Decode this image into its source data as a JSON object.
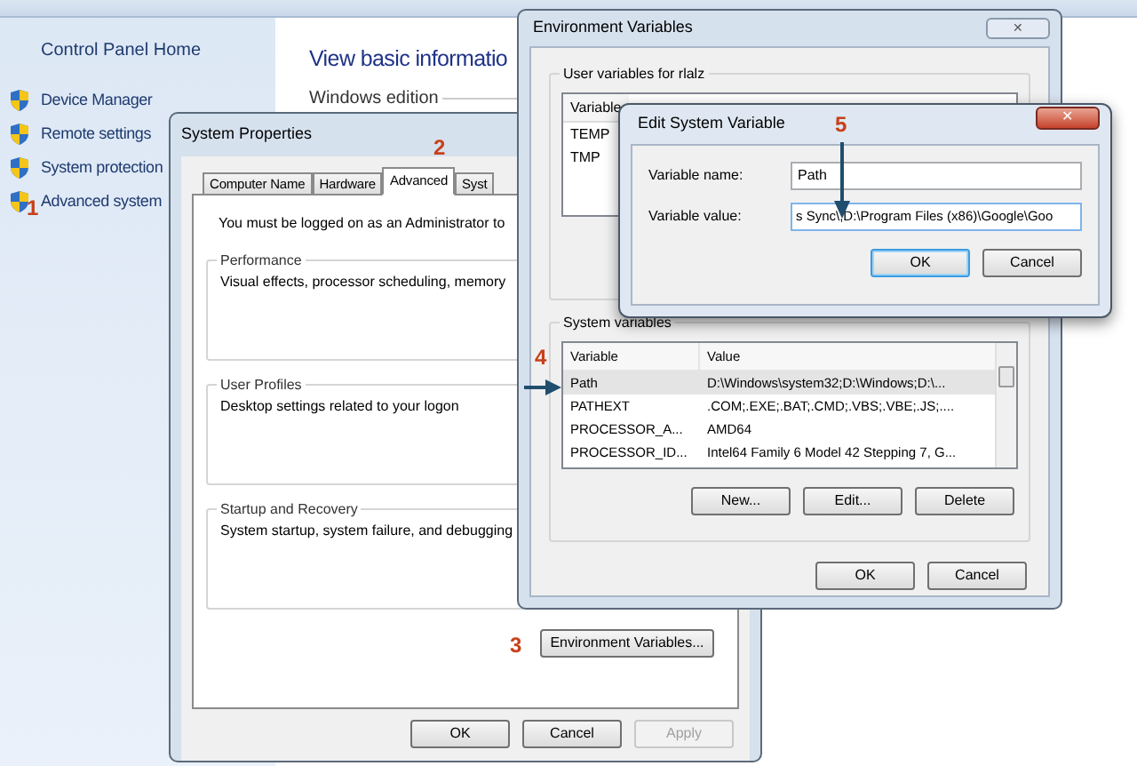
{
  "control_panel": {
    "home_link": "Control Panel Home",
    "tasks": [
      {
        "label": "Device Manager"
      },
      {
        "label": "Remote settings"
      },
      {
        "label": "System protection"
      },
      {
        "label": "Advanced system"
      }
    ],
    "heading": "View basic informatio",
    "section": "Windows edition"
  },
  "system_properties": {
    "title": "System Properties",
    "tabs": [
      {
        "label": "Computer Name",
        "selected": false
      },
      {
        "label": "Hardware",
        "selected": false
      },
      {
        "label": "Advanced",
        "selected": true
      },
      {
        "label": "Syst",
        "selected": false
      }
    ],
    "notice": "You must be logged on as an Administrator to",
    "groups": [
      {
        "title": "Performance",
        "description": "Visual effects, processor scheduling, memory"
      },
      {
        "title": "User Profiles",
        "description": "Desktop settings related to your logon"
      },
      {
        "title": "Startup and Recovery",
        "description": "System startup, system failure, and debugging"
      }
    ],
    "env_button": "Environment Variables...",
    "buttons": [
      {
        "label": "OK",
        "disabled": false
      },
      {
        "label": "Cancel",
        "disabled": false
      },
      {
        "label": "Apply",
        "disabled": true
      }
    ]
  },
  "environment_variables": {
    "title": "Environment Variables",
    "close": "✕",
    "user_section": {
      "title": "User variables for rlalz",
      "column": "Variable",
      "rows": [
        "TEMP",
        "TMP"
      ]
    },
    "system_section": {
      "title": "System variables",
      "columns": [
        "Variable",
        "Value"
      ],
      "rows": [
        {
          "name": "Path",
          "value": "D:\\Windows\\system32;D:\\Windows;D:\\...",
          "selected": true
        },
        {
          "name": "PATHEXT",
          "value": ".COM;.EXE;.BAT;.CMD;.VBS;.VBE;.JS;....",
          "selected": false
        },
        {
          "name": "PROCESSOR_A...",
          "value": "AMD64",
          "selected": false
        },
        {
          "name": "PROCESSOR_ID...",
          "value": "Intel64 Family 6 Model 42 Stepping 7, G...",
          "selected": false
        }
      ],
      "buttons": [
        "New...",
        "Edit...",
        "Delete"
      ]
    },
    "buttons": [
      "OK",
      "Cancel"
    ]
  },
  "edit_dialog": {
    "title": "Edit System Variable",
    "close": "✕",
    "name_label": "Variable name:",
    "name_value": "Path",
    "value_label": "Variable value:",
    "value_value": "s Sync\\;D:\\Program Files (x86)\\Google\\Goo",
    "buttons": [
      {
        "label": "OK",
        "focused": true
      },
      {
        "label": "Cancel",
        "focused": false
      }
    ]
  },
  "annotations": [
    {
      "label": "1"
    },
    {
      "label": "2"
    },
    {
      "label": "3"
    },
    {
      "label": "4"
    },
    {
      "label": "5"
    }
  ]
}
